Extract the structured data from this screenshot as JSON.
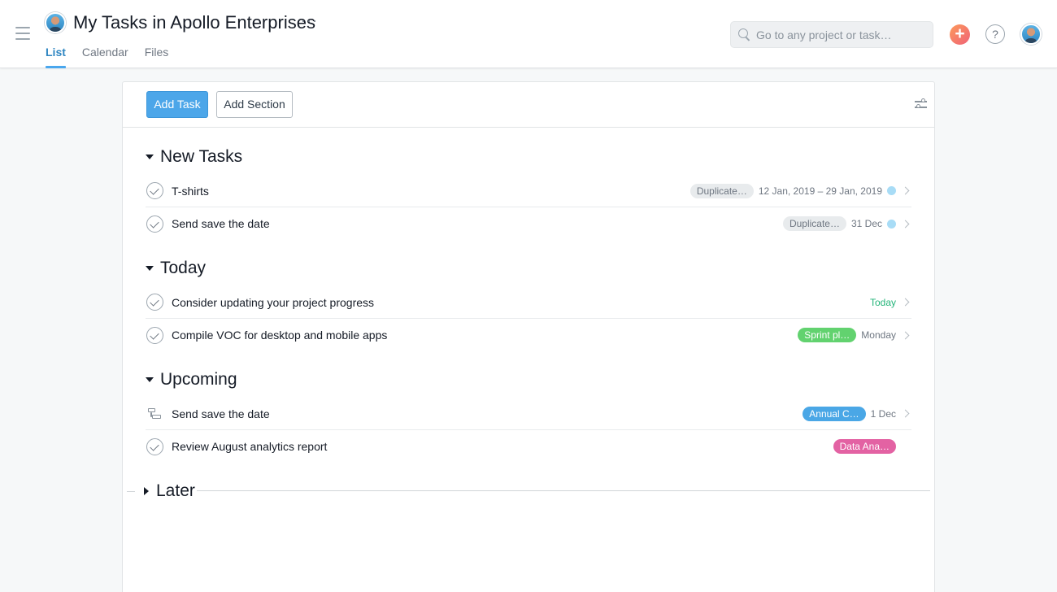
{
  "header": {
    "title": "My Tasks in Apollo Enterprises",
    "more_label": "···",
    "tabs": [
      {
        "label": "List",
        "active": true
      },
      {
        "label": "Calendar",
        "active": false
      },
      {
        "label": "Files",
        "active": false
      }
    ],
    "search_placeholder": "Go to any project or task…",
    "plus_label": "+",
    "help_label": "?"
  },
  "toolbar": {
    "add_task_label": "Add Task",
    "add_section_label": "Add Section"
  },
  "sections": [
    {
      "title": "New Tasks",
      "expanded": true,
      "tasks": [
        {
          "name": "T-shirts",
          "tag": "Duplicate…",
          "tag_color": "gray",
          "date": "12 Jan, 2019 – 29 Jan, 2019",
          "dot": true
        },
        {
          "name": "Send save the date",
          "tag": "Duplicate…",
          "tag_color": "gray",
          "date": "31 Dec",
          "dot": true
        }
      ]
    },
    {
      "title": "Today",
      "expanded": true,
      "tasks": [
        {
          "name": "Consider updating your project progress",
          "tag": "",
          "date": "Today",
          "date_style": "today"
        },
        {
          "name": "Compile VOC for desktop and mobile apps",
          "tag": "Sprint pl…",
          "tag_color": "green",
          "date": "Monday"
        }
      ]
    },
    {
      "title": "Upcoming",
      "expanded": true,
      "tasks": [
        {
          "name": "Send save the date",
          "tag": "Annual C…",
          "tag_color": "blue",
          "date": "1 Dec",
          "icon": "subtask"
        },
        {
          "name": "Review August analytics report",
          "tag": "Data Ana…",
          "tag_color": "pink",
          "date": ""
        }
      ]
    },
    {
      "title": "Later",
      "expanded": false,
      "tasks": []
    }
  ],
  "colors": {
    "accent": "#4ca6e9",
    "tab_active": "#2f86c2",
    "tag_green": "#62d26f",
    "tag_blue": "#4aa7e6",
    "tag_pink": "#e362a3",
    "today": "#25b57a"
  }
}
